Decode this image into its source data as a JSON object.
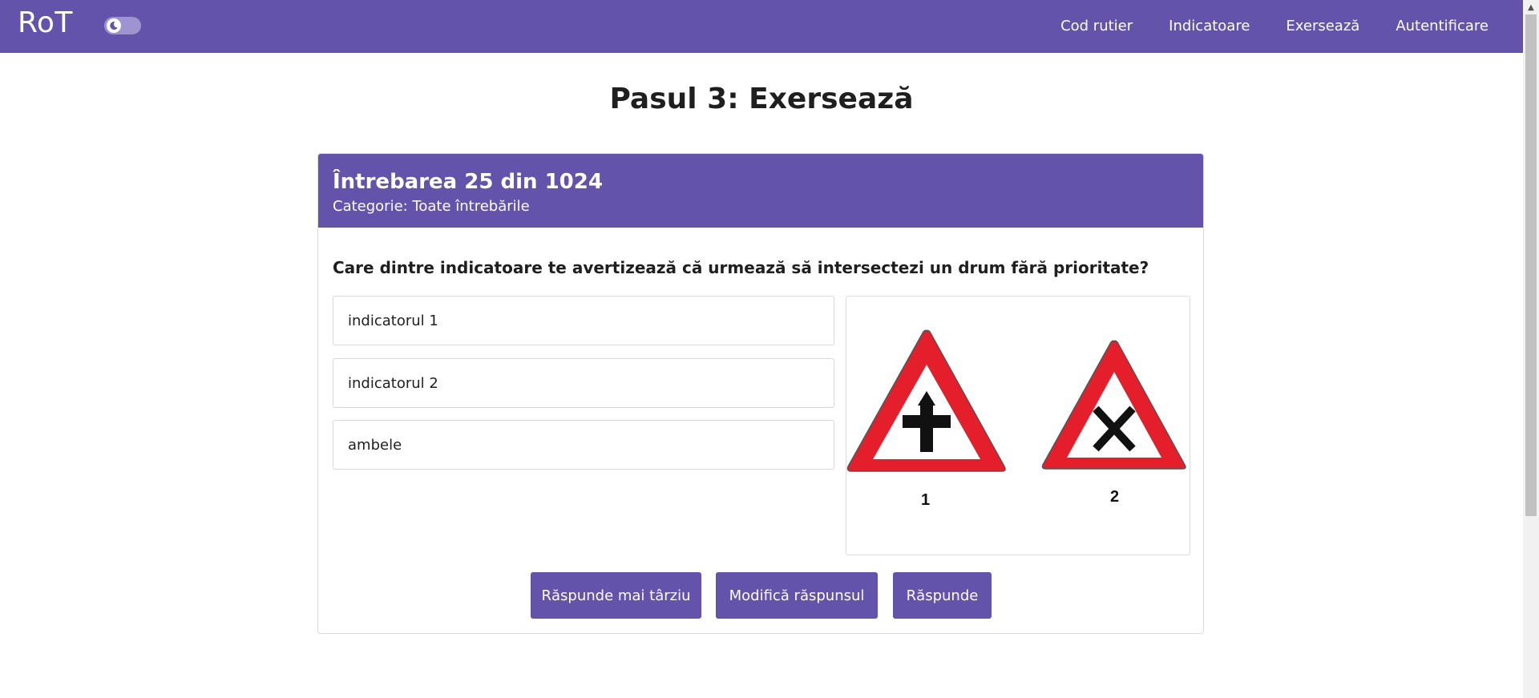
{
  "nav": {
    "brand": "RoT",
    "links": [
      "Cod rutier",
      "Indicatoare",
      "Exersează",
      "Autentificare"
    ]
  },
  "page": {
    "title": "Pasul 3: Exersează"
  },
  "quiz": {
    "header": "Întrebarea 25 din 1024",
    "category": "Categorie: Toate întrebările",
    "question": "Care dintre indicatoare te avertizează că urmează să intersectezi un drum fără prioritate?",
    "options": [
      "indicatorul 1",
      "indicatorul 2",
      "ambele"
    ],
    "image_labels": [
      "1",
      "2"
    ],
    "buttons": {
      "later": "Răspunde mai târziu",
      "modify": "Modifică răspunsul",
      "answer": "Răspunde"
    }
  },
  "colors": {
    "primary": "#6453ab",
    "sign_red": "#e41e2a"
  },
  "icons": {
    "theme_toggle": "moon-icon"
  }
}
